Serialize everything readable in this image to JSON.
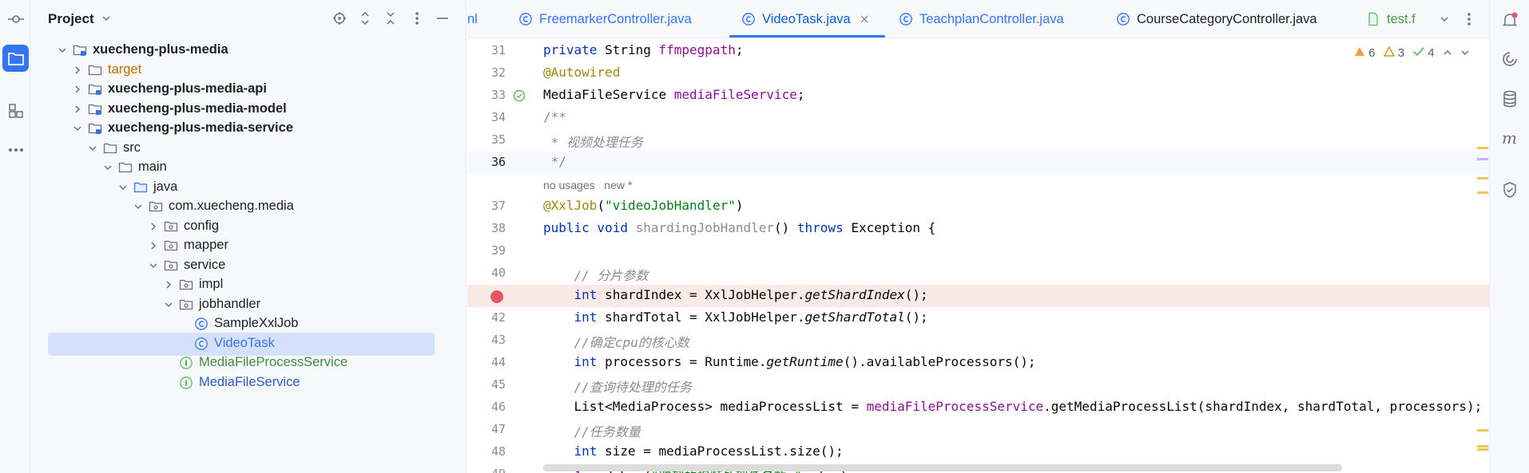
{
  "project_panel": {
    "title": "Project",
    "tree": [
      {
        "label": "xuecheng-plus-media",
        "depth": 0,
        "expanded": true,
        "icon": "module-folder-icon",
        "style": "bold"
      },
      {
        "label": "target",
        "depth": 1,
        "expanded": false,
        "icon": "folder-icon",
        "style": "excluded"
      },
      {
        "label": "xuecheng-plus-media-api",
        "depth": 1,
        "expanded": false,
        "icon": "module-folder-icon",
        "style": "bold"
      },
      {
        "label": "xuecheng-plus-media-model",
        "depth": 1,
        "expanded": false,
        "icon": "module-folder-icon",
        "style": "bold"
      },
      {
        "label": "xuecheng-plus-media-service",
        "depth": 1,
        "expanded": true,
        "icon": "module-folder-icon",
        "style": "bold"
      },
      {
        "label": "src",
        "depth": 2,
        "expanded": true,
        "icon": "folder-icon",
        "style": "normal"
      },
      {
        "label": "main",
        "depth": 3,
        "expanded": true,
        "icon": "folder-icon",
        "style": "normal"
      },
      {
        "label": "java",
        "depth": 4,
        "expanded": true,
        "icon": "source-folder-icon",
        "style": "normal"
      },
      {
        "label": "com.xuecheng.media",
        "depth": 5,
        "expanded": true,
        "icon": "package-icon",
        "style": "normal"
      },
      {
        "label": "config",
        "depth": 6,
        "expanded": false,
        "icon": "package-icon",
        "style": "normal"
      },
      {
        "label": "mapper",
        "depth": 6,
        "expanded": false,
        "icon": "package-icon",
        "style": "normal"
      },
      {
        "label": "service",
        "depth": 6,
        "expanded": true,
        "icon": "package-icon",
        "style": "normal"
      },
      {
        "label": "impl",
        "depth": 7,
        "expanded": false,
        "icon": "package-icon",
        "style": "normal"
      },
      {
        "label": "jobhandler",
        "depth": 7,
        "expanded": true,
        "icon": "package-icon",
        "style": "normal"
      },
      {
        "label": "SampleXxlJob",
        "depth": 8,
        "expanded": null,
        "icon": "class-icon",
        "style": "normal"
      },
      {
        "label": "VideoTask",
        "depth": 8,
        "expanded": null,
        "icon": "class-icon",
        "style": "new",
        "selected": true
      },
      {
        "label": "MediaFileProcessService",
        "depth": 7,
        "expanded": null,
        "icon": "interface-icon",
        "style": "added"
      },
      {
        "label": "MediaFileService",
        "depth": 7,
        "expanded": null,
        "icon": "interface-icon",
        "style": "modified"
      }
    ]
  },
  "tabs": [
    {
      "label": "nl",
      "icon": "",
      "color": "#3574f0"
    },
    {
      "label": "FreemarkerController.java",
      "icon": "class-icon",
      "color": "#3574f0"
    },
    {
      "label": "VideoTask.java",
      "icon": "class-icon",
      "color": "#0b5cd5",
      "active": true,
      "closable": true
    },
    {
      "label": "TeachplanController.java",
      "icon": "class-icon",
      "color": "#3574f0"
    },
    {
      "label": "CourseCategoryController.java",
      "icon": "class-icon",
      "color": "#1f1f1f"
    },
    {
      "label": "test.f",
      "icon": "file-icon",
      "color": "#4a9a4a"
    }
  ],
  "inspections": {
    "warnings": "6",
    "weak_warnings": "3",
    "ok": "4"
  },
  "editor": {
    "hint_usages": "no usages",
    "hint_new": "new *"
  },
  "colors": {
    "accent": "#3574f0",
    "selection": "#d5e1fb",
    "breakpoint": "#e55765",
    "keyword": "#0033b3",
    "annotation": "#9e880d",
    "field": "#871094",
    "string": "#067d17"
  }
}
